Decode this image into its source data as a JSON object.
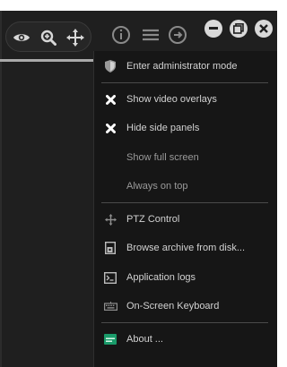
{
  "toolbar": {
    "icons": [
      "eye-icon",
      "zoom-in-icon",
      "move-icon"
    ]
  },
  "window_controls": [
    "minimize-icon",
    "restore-icon",
    "close-icon"
  ],
  "header_icons": [
    "info-icon",
    "menu-icon",
    "forward-icon"
  ],
  "menu": {
    "items": [
      {
        "label": "Enter administrator mode",
        "icon": "shield-icon",
        "state": "normal"
      },
      {
        "label": "Show video overlays",
        "icon": "x-icon",
        "state": "normal"
      },
      {
        "label": "Hide side panels",
        "icon": "x-icon",
        "state": "normal"
      },
      {
        "label": "Show full screen",
        "icon": "",
        "state": "dim"
      },
      {
        "label": "Always on top",
        "icon": "",
        "state": "dim"
      },
      {
        "label": "PTZ Control",
        "icon": "ptz-icon",
        "state": "normal"
      },
      {
        "label": "Browse archive from disk...",
        "icon": "archive-icon",
        "state": "normal"
      },
      {
        "label": "Application logs",
        "icon": "logs-icon",
        "state": "normal"
      },
      {
        "label": "On-Screen Keyboard",
        "icon": "keyboard-icon",
        "state": "normal"
      },
      {
        "label": "About ...",
        "icon": "about-icon",
        "state": "normal"
      }
    ]
  },
  "colors": {
    "background": "#1f1f1f",
    "menu_background": "#161616",
    "text": "#d2d2d2",
    "dim_text": "#9a9a9a",
    "about_icon": "#1a9b6a"
  }
}
